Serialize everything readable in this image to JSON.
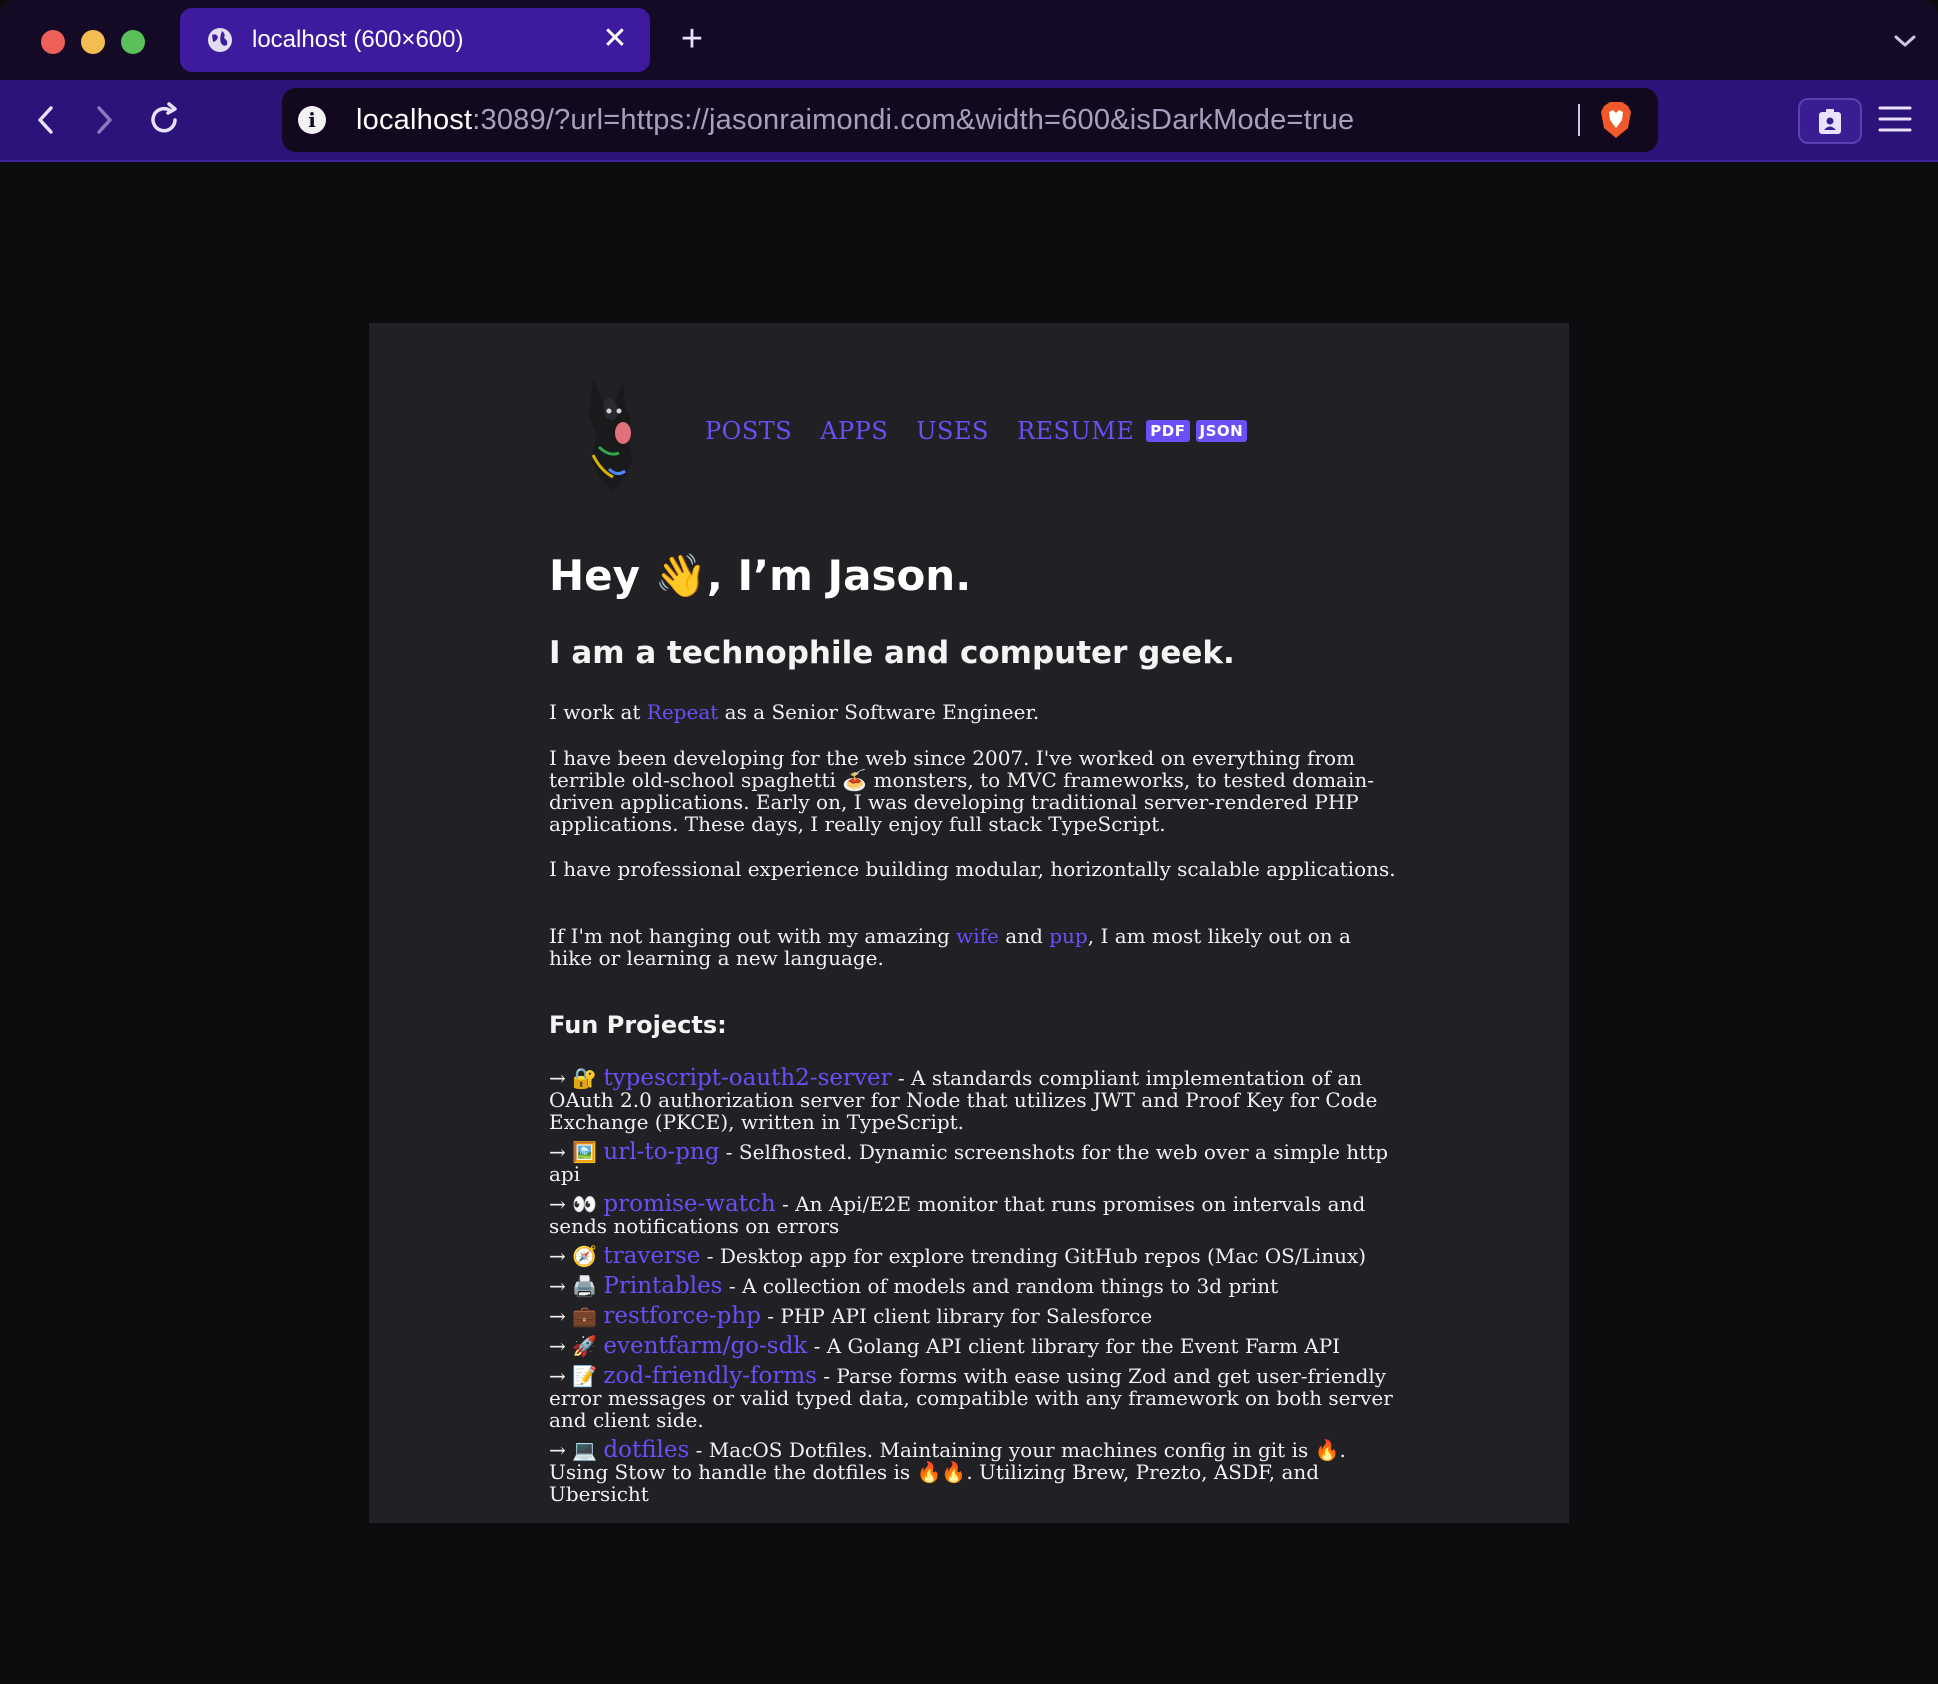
{
  "browser": {
    "tab_title": "localhost (600×600)",
    "tab_close": "✕",
    "new_tab": "+",
    "url_host": "localhost",
    "url_rest": ":3089/?url=https://jasonraimondi.com&width=600&isDarkMode=true",
    "info_glyph": "i"
  },
  "site": {
    "nav": [
      {
        "label": "POSTS"
      },
      {
        "label": "APPS"
      },
      {
        "label": "USES"
      },
      {
        "label": "RESUME"
      }
    ],
    "badges": {
      "pdf": "PDF",
      "json": "JSON"
    },
    "hero": "Hey 👋, I’m Jason.",
    "subtitle": "I am a technophile and computer geek.",
    "p1": {
      "before": "I work at ",
      "link": "Repeat",
      "after": " as a Senior Software Engineer."
    },
    "p2": "I have been developing for the web since 2007. I've worked on everything from terrible old-school spaghetti 🍝 monsters, to MVC frameworks, to tested domain-driven applications. Early on, I was developing traditional server-rendered PHP applications. These days, I really enjoy full stack TypeScript.",
    "p3": "I have professional experience building modular, horizontally scalable applications.",
    "p4": {
      "before": "If I'm not hanging out with my amazing ",
      "link1": "wife",
      "mid": " and ",
      "link2": "pup",
      "after": ", I am most likely out on a hike or learning a new language."
    },
    "fun_heading": "Fun Projects:",
    "projects": [
      {
        "arrow": "→",
        "emoji": "🔐",
        "name": "typescript-oauth2-server",
        "desc": " - A standards compliant implementation of an OAuth 2.0 authorization server for Node that utilizes JWT and Proof Key for Code Exchange (PKCE), written in TypeScript."
      },
      {
        "arrow": "→",
        "emoji": "🖼️",
        "name": "url-to-png",
        "desc": " - Selfhosted. Dynamic screenshots for the web over a simple http api"
      },
      {
        "arrow": "→",
        "emoji": "👀",
        "name": "promise-watch",
        "desc": " - An Api/E2E monitor that runs promises on intervals and sends notifications on errors"
      },
      {
        "arrow": "→",
        "emoji": "🧭",
        "name": "traverse",
        "desc": " - Desktop app for explore trending GitHub repos (Mac OS/Linux)"
      },
      {
        "arrow": "→",
        "emoji": "🖨️",
        "name": "Printables",
        "desc": " - A collection of models and random things to 3d print"
      },
      {
        "arrow": "→",
        "emoji": "💼",
        "name": "restforce-php",
        "desc": " - PHP API client library for Salesforce"
      },
      {
        "arrow": "→",
        "emoji": "🚀",
        "name": "eventfarm/go-sdk",
        "desc": " - A Golang API client library for the Event Farm API"
      },
      {
        "arrow": "→",
        "emoji": "📝",
        "name": "zod-friendly-forms",
        "desc": " - Parse forms with ease using Zod and get user-friendly error messages or valid typed data, compatible with any framework on both server and client side."
      },
      {
        "arrow": "→",
        "emoji": "💻",
        "name": "dotfiles",
        "desc": " - MacOS Dotfiles. Maintaining your machines config in git is 🔥. Using Stow to handle the dotfiles is 🔥🔥. Utilizing Brew, Prezto, ASDF, and Ubersicht"
      }
    ]
  },
  "colors": {
    "accent": "#6b4ef5",
    "page_bg": "#212125",
    "tab_active": "#3e1b9e",
    "toolbar": "#2c137a"
  }
}
